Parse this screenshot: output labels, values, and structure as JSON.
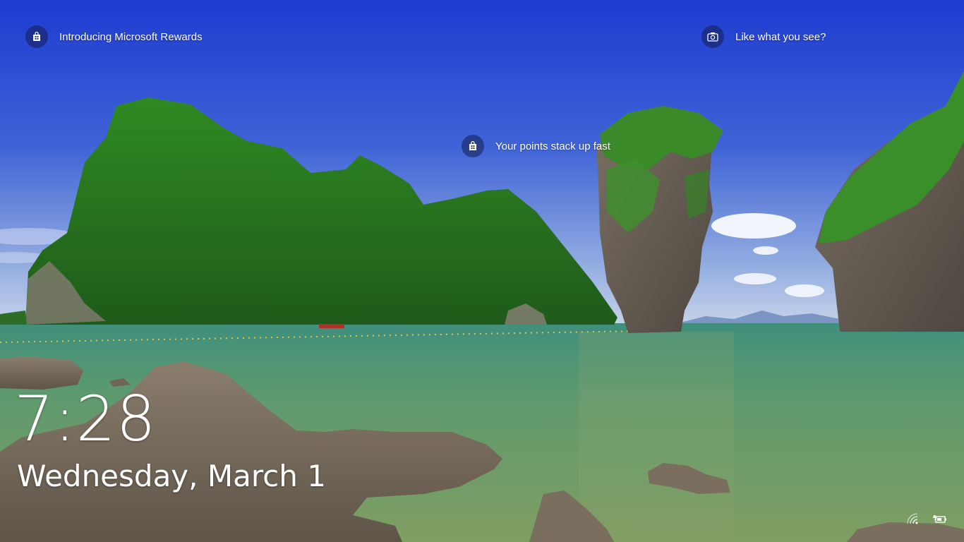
{
  "lockscreen": {
    "spotlight": {
      "rewards_title": "Introducing Microsoft Rewards",
      "like_prompt": "Like what you see?",
      "points_hint": "Your points stack up fast"
    },
    "time": "7:28",
    "date": "Wednesday, March 1"
  },
  "status_icons": [
    "wifi-icon",
    "battery-icon"
  ],
  "colors": {
    "sky_top": "#1e3fd1",
    "sea": "#5f9a6e",
    "text": "#ffffff"
  }
}
